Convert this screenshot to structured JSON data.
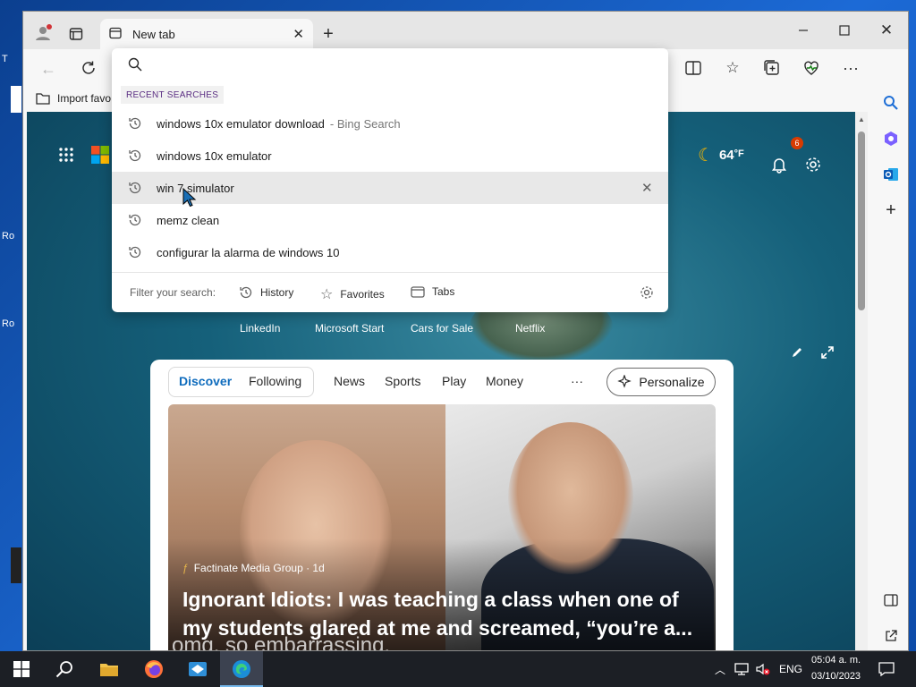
{
  "browser": {
    "tab_title": "New tab",
    "favbar_import": "Import favo"
  },
  "address": {
    "placeholder": "",
    "recent_label": "RECENT SEARCHES",
    "suggestions": [
      {
        "text": "windows 10x emulator download",
        "extra": "- Bing Search"
      },
      {
        "text": "windows 10x emulator",
        "extra": ""
      },
      {
        "text": "win 7 simulator",
        "extra": ""
      },
      {
        "text": "memz clean",
        "extra": ""
      },
      {
        "text": "configurar la alarma de windows 10",
        "extra": ""
      }
    ],
    "filter_label": "Filter your search:",
    "filters": [
      "History",
      "Favorites",
      "Tabs"
    ]
  },
  "page": {
    "weather_temp": "64",
    "weather_unit": "°F",
    "notification_count": "6",
    "quick_links": [
      "LinkedIn",
      "Microsoft Start",
      "Cars for Sale",
      "Netflix"
    ]
  },
  "feed": {
    "tabs": [
      "Discover",
      "Following",
      "News",
      "Sports",
      "Play",
      "Money"
    ],
    "more": "···",
    "personalize": "Personalize",
    "source": "Factinate Media Group · 1d",
    "headline": "Ignorant Idiots: I was teaching a class when one of my students glared at me and screamed, “you’re a...",
    "caption": "omg. so embarrassing."
  },
  "desktop": {
    "edge_labels": [
      "T",
      "Ro",
      "Ro"
    ]
  },
  "taskbar": {
    "language": "ENG",
    "time": "05:04 a. m.",
    "date": "03/10/2023"
  },
  "colors": {
    "accent": "#0f6cbd",
    "badge": "#d83b01",
    "taskbar": "#1c1f25"
  },
  "icons": [
    "profile-icon",
    "tab-actions-icon",
    "new-tab-icon",
    "back-icon",
    "refresh-icon",
    "search-icon",
    "history-icon",
    "close-icon",
    "star-icon",
    "tabs-icon",
    "gear-icon",
    "split-screen-icon",
    "favorites-icon",
    "collections-icon",
    "performance-icon",
    "more-icon",
    "bing-icon",
    "apps-grid-icon",
    "microsoft-logo",
    "moon-icon",
    "bell-icon",
    "edit-icon",
    "expand-icon",
    "windows-start-icon",
    "taskbar-search-icon",
    "file-explorer-icon",
    "firefox-icon",
    "virtualbox-icon",
    "edge-icon",
    "chevron-up-icon",
    "network-icon",
    "volume-muted-icon",
    "notification-center-icon"
  ]
}
